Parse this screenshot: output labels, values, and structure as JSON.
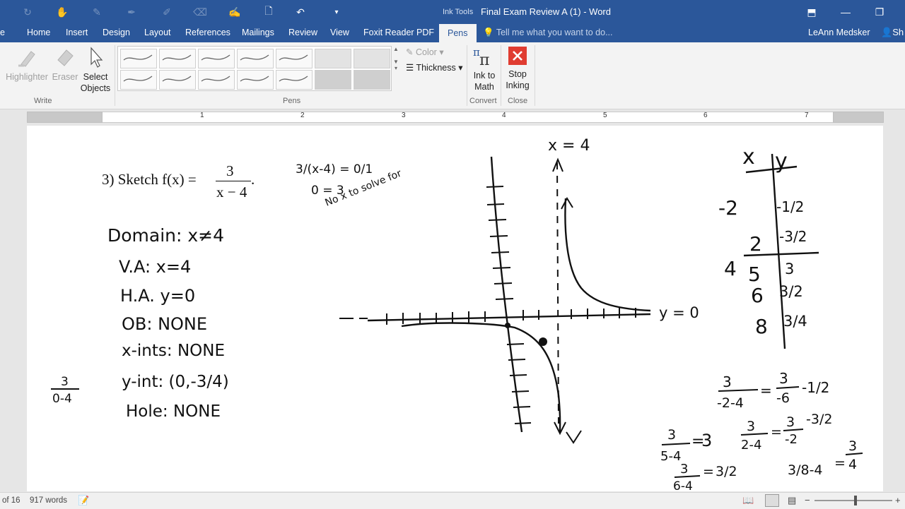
{
  "window": {
    "context_label": "Ink Tools",
    "title": "Final Exam Review A (1) - Word"
  },
  "tabs": [
    {
      "label": "e"
    },
    {
      "label": "Home"
    },
    {
      "label": "Insert"
    },
    {
      "label": "Design"
    },
    {
      "label": "Layout"
    },
    {
      "label": "References"
    },
    {
      "label": "Mailings"
    },
    {
      "label": "Review"
    },
    {
      "label": "View"
    },
    {
      "label": "Foxit Reader PDF"
    },
    {
      "label": "Pens"
    }
  ],
  "tell_me_placeholder": "Tell me what you want to do...",
  "user_name": "LeAnn Medsker",
  "share_label": "Sh",
  "ribbon": {
    "write": {
      "highlighter": "Highlighter",
      "eraser": "Eraser",
      "select_objects_1": "Select",
      "select_objects_2": "Objects",
      "group_label": "Write"
    },
    "pens": {
      "color_label": "Color",
      "thickness_label": "Thickness",
      "group_label": "Pens"
    },
    "convert": {
      "ink_to_math_1": "Ink to",
      "ink_to_math_2": "Math",
      "group_label": "Convert"
    },
    "close": {
      "stop_inking_1": "Stop",
      "stop_inking_2": "Inking",
      "group_label": "Close"
    }
  },
  "ruler": [
    "1",
    "2",
    "3",
    "4",
    "5",
    "6",
    "7"
  ],
  "document": {
    "problem_prefix": "3) Sketch f(x) =",
    "numerator": "3",
    "denominator": "x − 4",
    "suffix": ".",
    "ink_notes": {
      "domain": "Domain: x≠4",
      "va": "V.A: x=4",
      "ha": "H.A. y=0",
      "ob": "OB: NONE",
      "xints": "x-ints: NONE",
      "yint": "y-int: (0,-3/4)",
      "hole": "Hole: NONE",
      "side_frac_num": "3",
      "side_frac_den": "0-4",
      "solve_1": "3/(x-4) = 0/1",
      "solve_2": "0 = 3",
      "solve_3": "No x to solve for",
      "va_label": "x = 4",
      "ha_label": "y = 0",
      "table_x_head": "x",
      "table_y_head": "y",
      "table_x": [
        "-2",
        "2",
        "5",
        "6",
        "8"
      ],
      "table_y": [
        "-1/2",
        "-3/2",
        "3",
        "3/2",
        "3/4"
      ],
      "table_side": "4",
      "calc_1_num": "3",
      "calc_1_den": "-2-4",
      "calc_1_r1_num": "3",
      "calc_1_r1_den": "-6",
      "calc_1_r2": "-1/2",
      "calc_2_num": "3",
      "calc_2_den": "2-4",
      "calc_2_r1_num": "3",
      "calc_2_r1_den": "-2",
      "calc_2_r2": "-3/2",
      "calc_3_num": "3",
      "calc_3_den": "5-4",
      "calc_3_r": "3",
      "calc_4_num": "3",
      "calc_4_den": "6-4",
      "calc_4_r": "3/2",
      "calc_5": "3/8-4",
      "calc_5_r_num": "3",
      "calc_5_r_den": "4"
    }
  },
  "status": {
    "page": "of 16",
    "words": "917 words"
  },
  "colors": {
    "title_bar": "#2b579a",
    "ribbon": "#f3f3f3",
    "stop_inking": "#e03c31"
  }
}
